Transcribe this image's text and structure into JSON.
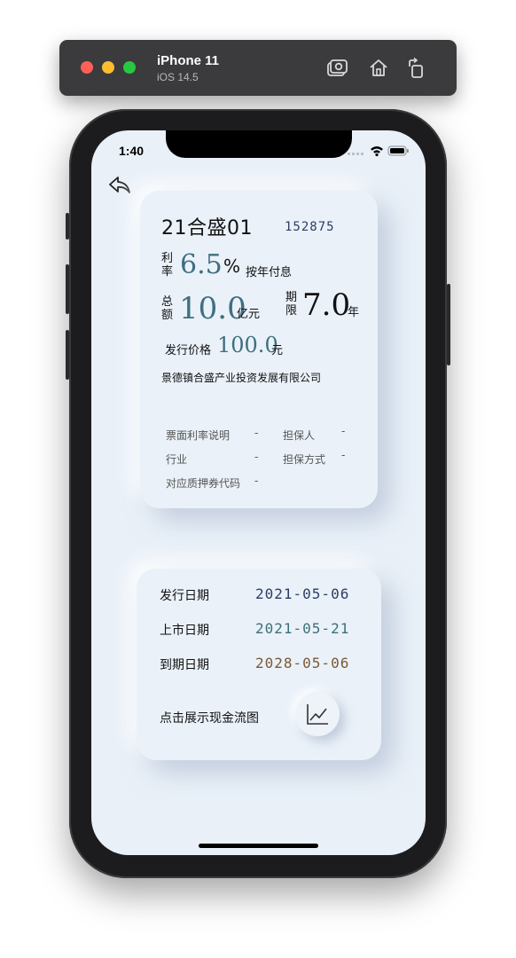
{
  "simulator": {
    "device": "iPhone 11",
    "os": "iOS 14.5",
    "buttons": [
      "screenshot-icon",
      "home-icon",
      "rotate-icon"
    ]
  },
  "status_bar": {
    "time": "1:40"
  },
  "bond": {
    "name": "21合盛01",
    "code": "152875",
    "rate_label": [
      "利",
      "率"
    ],
    "rate_value": "6.5",
    "rate_unit": "%",
    "rate_note": "按年付息",
    "amount_label": [
      "总",
      "额"
    ],
    "amount_value": "10.0",
    "amount_unit": "亿元",
    "term_label": [
      "期",
      "限"
    ],
    "term_value": "7.0",
    "term_unit": "年",
    "price_label": "发行价格",
    "price_value": "100.0",
    "price_unit": "元",
    "issuer": "景德镇合盛产业投资发展有限公司",
    "coupon_note_label": "票面利率说明",
    "coupon_note_value": "-",
    "guarantor_label": "担保人",
    "guarantor_value": "-",
    "industry_label": "行业",
    "industry_value": "-",
    "guarantee_type_label": "担保方式",
    "guarantee_type_value": "-",
    "pledge_code_label": "对应质押券代码",
    "pledge_code_value": "-"
  },
  "dates": {
    "issue_label": "发行日期",
    "issue_value": "2021-05-06",
    "listing_label": "上市日期",
    "listing_value": "2021-05-21",
    "maturity_label": "到期日期",
    "maturity_value": "2028-05-06",
    "cashflow_label": "点击展示现金流图"
  },
  "colors": {
    "accent_teal": "#3f6f80",
    "issue_date": "#2c3e63",
    "listing_date": "#3d6f78",
    "maturity_date": "#7a5a35",
    "screen_bg": "#e9f0f8"
  }
}
